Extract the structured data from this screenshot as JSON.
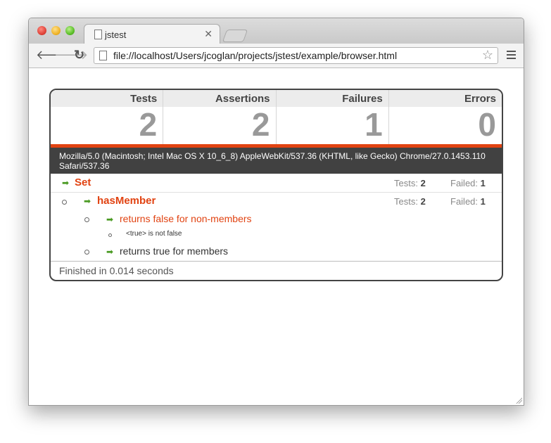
{
  "browser": {
    "tab_title": "jstest",
    "url": "file://localhost/Users/jcoglan/projects/jstest/example/browser.html"
  },
  "summary": {
    "tests_label": "Tests",
    "tests_value": "2",
    "assertions_label": "Assertions",
    "assertions_value": "2",
    "failures_label": "Failures",
    "failures_value": "1",
    "errors_label": "Errors",
    "errors_value": "0"
  },
  "user_agent": "Mozilla/5.0 (Macintosh; Intel Mac OS X 10_6_8) AppleWebKit/537.36 (KHTML, like Gecko) Chrome/27.0.1453.110 Safari/537.36",
  "results": {
    "set": {
      "name": "Set",
      "tests_label": "Tests:",
      "tests_value": "2",
      "failed_label": "Failed:",
      "failed_value": "1"
    },
    "has_member": {
      "name": "hasMember",
      "tests_label": "Tests:",
      "tests_value": "2",
      "failed_label": "Failed:",
      "failed_value": "1"
    },
    "test1": {
      "name": "returns false for non-members",
      "error": "<true> is not false"
    },
    "test2": {
      "name": "returns true for members"
    }
  },
  "footer": "Finished in 0.014 seconds"
}
